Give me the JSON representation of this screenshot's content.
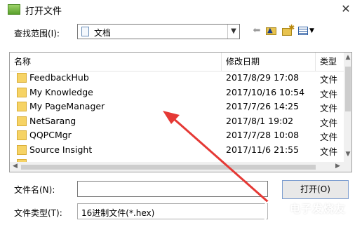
{
  "window": {
    "title": "打开文件"
  },
  "lookin": {
    "label": "查找范围(I):",
    "value": "文档"
  },
  "list": {
    "columns": {
      "name": "名称",
      "date": "修改日期",
      "type": "类型"
    },
    "rows": [
      {
        "name": "FeedbackHub",
        "date": "2017/8/29 17:08",
        "type": "文件"
      },
      {
        "name": "My Knowledge",
        "date": "2017/10/16 10:54",
        "type": "文件"
      },
      {
        "name": "My PageManager",
        "date": "2017/7/26 14:25",
        "type": "文件"
      },
      {
        "name": "NetSarang",
        "date": "2017/8/1 19:02",
        "type": "文件"
      },
      {
        "name": "QQPCMgr",
        "date": "2017/7/28 10:08",
        "type": "文件"
      },
      {
        "name": "Source Insight",
        "date": "2017/11/6 21:55",
        "type": "文件"
      }
    ]
  },
  "footer": {
    "filename_label": "文件名(N):",
    "filename_value": "",
    "filetype_label": "文件类型(T):",
    "filetype_value": "16进制文件(*.hex)",
    "open_label": "打开(O)"
  },
  "watermark": {
    "text": "电子发烧友",
    "url": "www.elecfans.com"
  },
  "colors": {
    "annotation_arrow": "#e53935",
    "folder": "#f6d365"
  }
}
